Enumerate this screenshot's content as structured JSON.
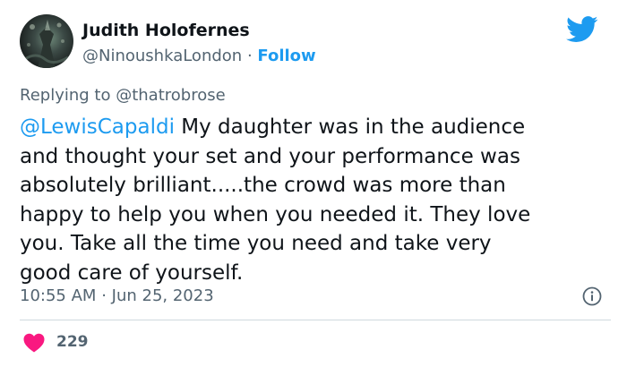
{
  "author": {
    "name": "Judith Holofernes",
    "handle": "@NinoushkaLondon",
    "separator": "·",
    "follow_label": "Follow"
  },
  "reply": {
    "prefix": "Replying to",
    "to": "@thatrobrose"
  },
  "tweet": {
    "mention": "@LewisCapaldi",
    "lines": [
      " My daughter was in the audience",
      "and thought your set and your performance was",
      "absolutely brilliant.....the crowd was more than",
      "happy to help you when you needed it.  They love",
      "you. Take all the time you need and take very",
      "good care of yourself."
    ]
  },
  "meta": {
    "time": "10:55 AM",
    "separator": "·",
    "date": "Jun 25, 2023"
  },
  "engagement": {
    "likes": "229"
  },
  "icons": {
    "brand": "twitter-bird-icon",
    "info": "info-icon",
    "like": "heart-icon"
  },
  "colors": {
    "accent": "#1d9bf0",
    "secondary_text": "#536471",
    "like": "#f91880",
    "divider": "#cfd9de"
  }
}
